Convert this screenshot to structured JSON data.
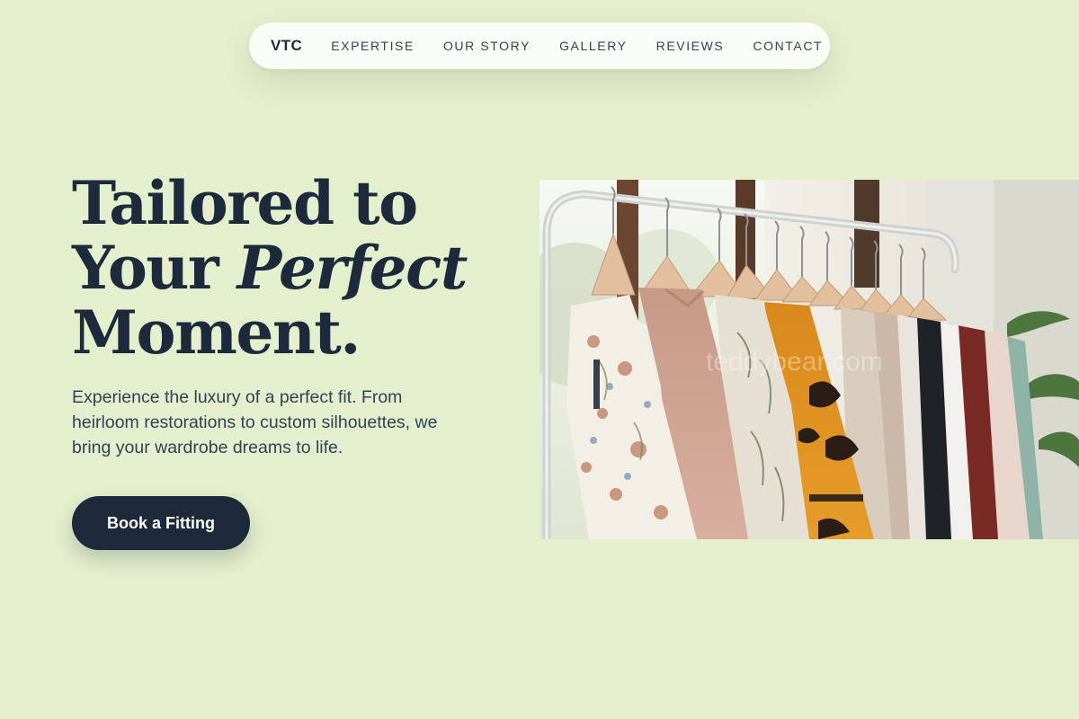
{
  "nav": {
    "brand": "VTC",
    "links": [
      "EXPERTISE",
      "OUR STORY",
      "GALLERY",
      "REVIEWS",
      "CONTACT"
    ]
  },
  "hero": {
    "headline_line1": "Tailored to",
    "headline_line2_plain": "Your ",
    "headline_line2_italic": "Perfect",
    "headline_line3": "Moment.",
    "lead": "Experience the luxury of a perfect fit. From heirloom restorations to custom silhouettes, we bring your wardrobe dreams to life.",
    "cta_label": "Book a Fitting"
  },
  "image": {
    "watermark": "teddybear.com"
  },
  "colors": {
    "background": "#e4efcd",
    "navy": "#1e293b",
    "nav_pill": "#fafcf7"
  }
}
